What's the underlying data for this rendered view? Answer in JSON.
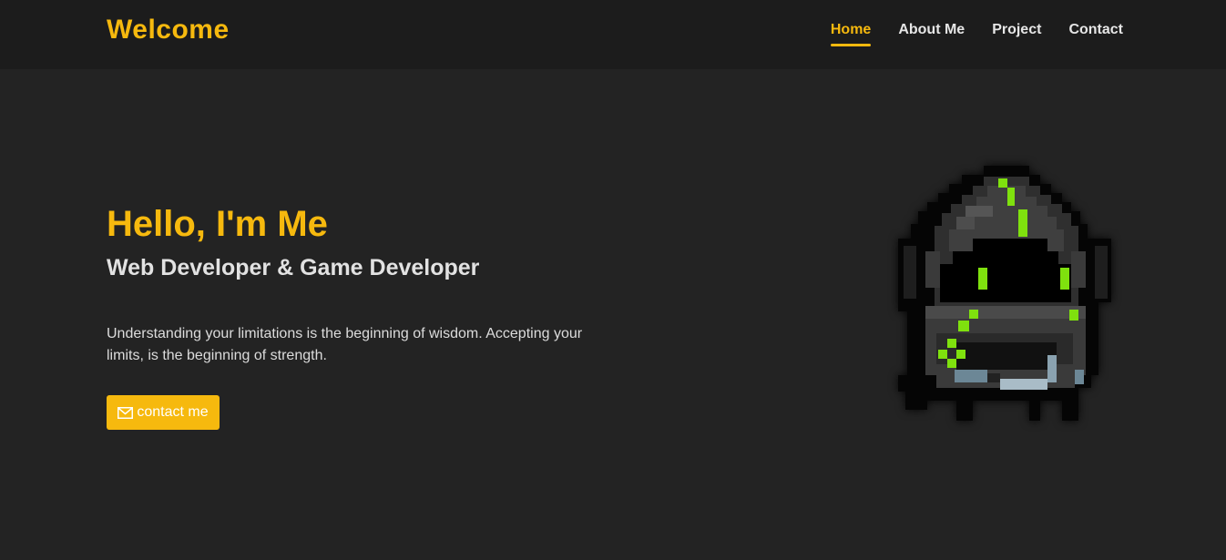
{
  "nav": {
    "brand": "Welcome",
    "links": [
      {
        "label": "Home",
        "active": true
      },
      {
        "label": "About Me",
        "active": false
      },
      {
        "label": "Project",
        "active": false
      },
      {
        "label": "Contact",
        "active": false
      }
    ]
  },
  "hero": {
    "title": "Hello, I'm Me",
    "subtitle": "Web Developer & Game Developer",
    "quote": "Understanding your limitations is the beginning of wisdom. Accepting your limits, is the beginning of strength.",
    "button_label": "contact me",
    "button_icon": "envelope-icon",
    "image": "pixel-art-hooded-robot"
  },
  "colors": {
    "accent": "#f6b90e",
    "background": "#232323",
    "navbar": "#1c1c1c",
    "text": "#e2e2e2",
    "pixel_green": "#7fe10e"
  }
}
